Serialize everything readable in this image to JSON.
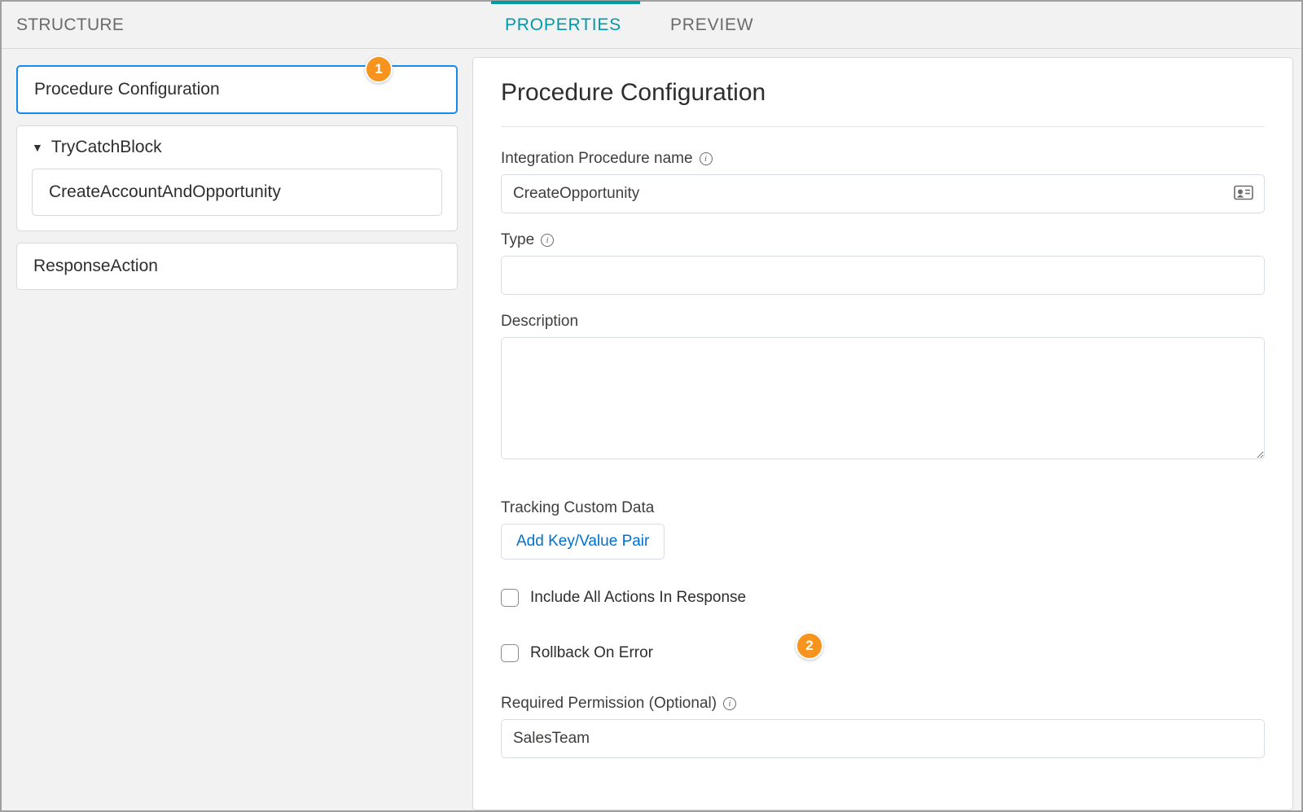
{
  "sidebar": {
    "header": "STRUCTURE",
    "selected_item": "Procedure Configuration",
    "group": {
      "label": "TryCatchBlock",
      "child": "CreateAccountAndOpportunity"
    },
    "item3": "ResponseAction"
  },
  "tabs": {
    "properties": "PROPERTIES",
    "preview": "PREVIEW"
  },
  "panel": {
    "title": "Procedure Configuration",
    "name_label": "Integration Procedure name",
    "name_value": "CreateOpportunity",
    "type_label": "Type",
    "type_value": "",
    "description_label": "Description",
    "description_value": "",
    "tracking_label": "Tracking Custom Data",
    "add_kv_label": "Add Key/Value Pair",
    "include_all_label": "Include All Actions In Response",
    "rollback_label": "Rollback On Error",
    "required_permission_label": "Required Permission (Optional)",
    "required_permission_value": "SalesTeam"
  },
  "badges": {
    "one": "1",
    "two": "2"
  },
  "layout": {
    "panel_offset_top": "0"
  }
}
